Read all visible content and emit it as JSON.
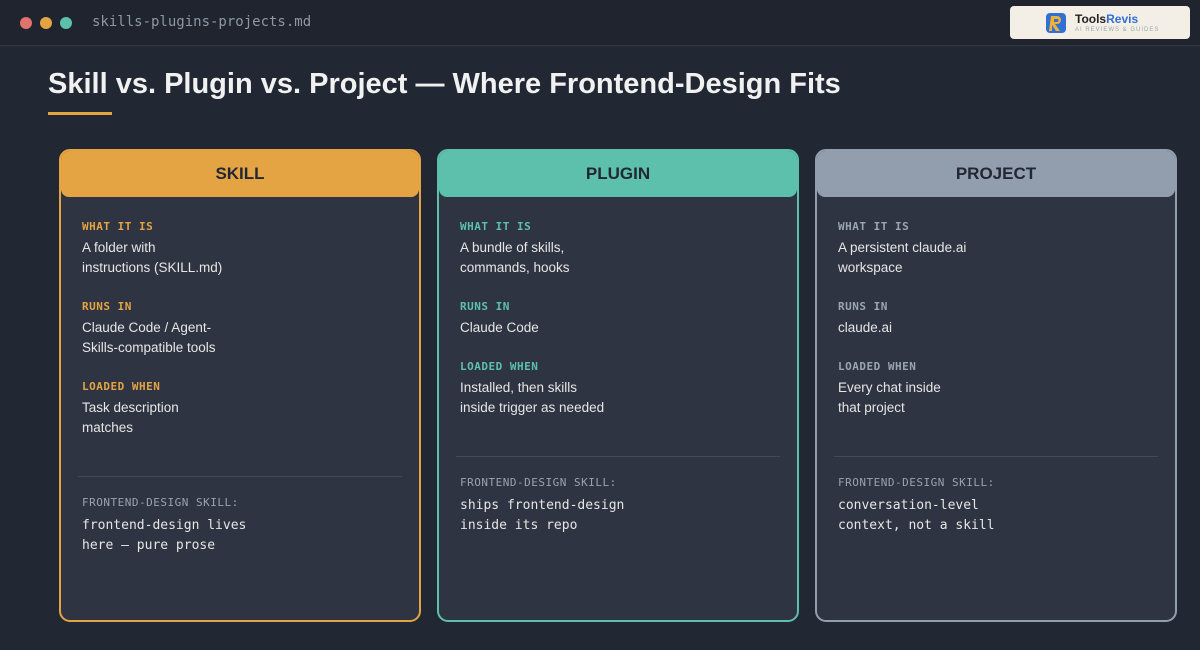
{
  "window": {
    "filename": "skills-plugins-projects.md"
  },
  "logo": {
    "name_part1": "Tools",
    "name_part2": "Revis",
    "tagline": "AI REVIEWS & GUIDES"
  },
  "page": {
    "title": "Skill vs. Plugin vs. Project — Where Frontend-Design Fits"
  },
  "colors": {
    "skill_accent": "#e5a444",
    "plugin_accent": "#5cc0ad",
    "project_accent": "#929eae",
    "background": "#222833",
    "card_background": "#2e3441"
  },
  "cards": [
    {
      "title": "SKILL",
      "what_label": "WHAT IT IS",
      "what_text": "A folder with\ninstructions (SKILL.md)",
      "runs_label": "RUNS IN",
      "runs_text": "Claude Code / Agent-\nSkills-compatible tools",
      "loaded_label": "LOADED WHEN",
      "loaded_text": "Task description\nmatches",
      "fd_label": "FRONTEND-DESIGN SKILL:",
      "fd_text": "frontend-design lives\nhere — pure prose"
    },
    {
      "title": "PLUGIN",
      "what_label": "WHAT IT IS",
      "what_text": "A bundle of skills,\ncommands, hooks",
      "runs_label": "RUNS IN",
      "runs_text": "Claude Code",
      "loaded_label": "LOADED WHEN",
      "loaded_text": "Installed, then skills\ninside trigger as needed",
      "fd_label": "FRONTEND-DESIGN SKILL:",
      "fd_text": "ships frontend-design\ninside its repo"
    },
    {
      "title": "PROJECT",
      "what_label": "WHAT IT IS",
      "what_text": "A persistent claude.ai\nworkspace",
      "runs_label": "RUNS IN",
      "runs_text": "claude.ai",
      "loaded_label": "LOADED WHEN",
      "loaded_text": "Every chat inside\nthat project",
      "fd_label": "FRONTEND-DESIGN SKILL:",
      "fd_text": "conversation-level\ncontext, not a skill"
    }
  ]
}
